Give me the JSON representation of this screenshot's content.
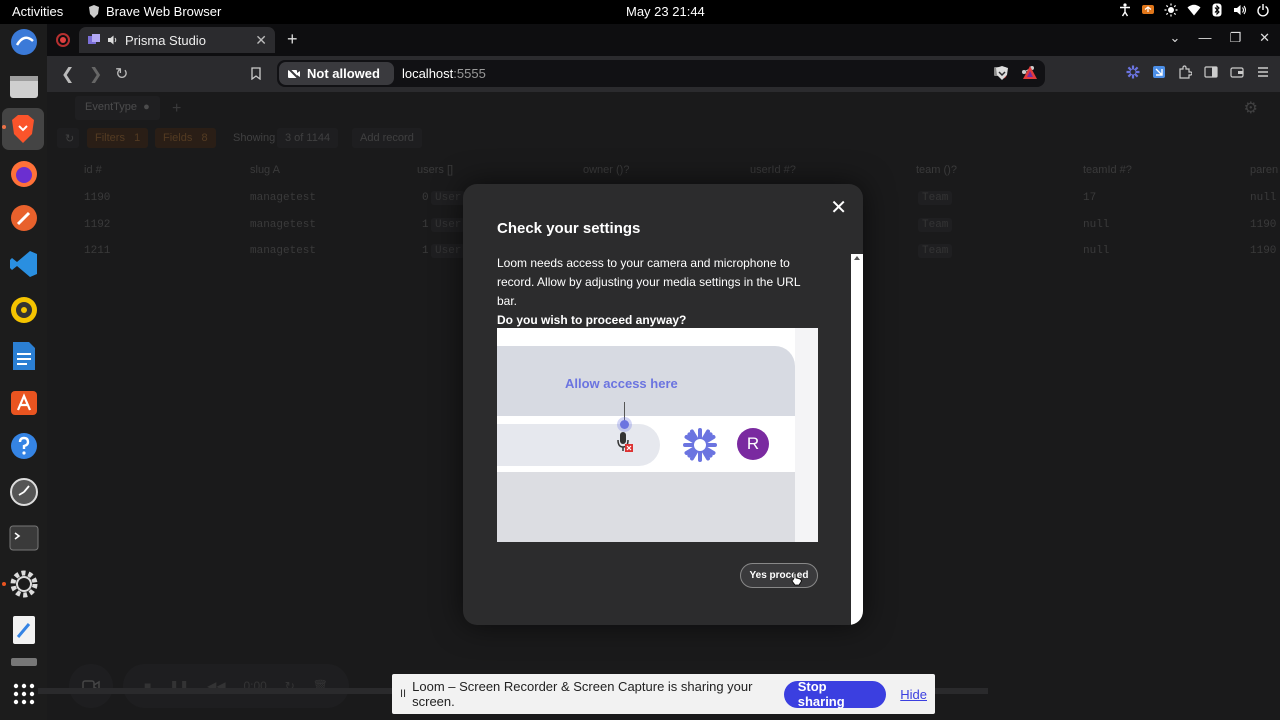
{
  "topbar": {
    "activities": "Activities",
    "app_name": "Brave Web Browser",
    "clock": "May 23  21:44"
  },
  "dock": {
    "items": [
      "browser-globe",
      "files",
      "brave",
      "firefox",
      "pen-app",
      "vscode",
      "rhythmbox",
      "writer",
      "app-center",
      "help",
      "clock",
      "terminal",
      "settings",
      "text-editor",
      "trash",
      "show-apps"
    ]
  },
  "browser": {
    "tab_title": "Prisma Studio",
    "new_tab": "+",
    "permission_label": "Not allowed",
    "url_host": "localhost",
    "url_port": ":5555"
  },
  "app": {
    "model_tab": "EventType",
    "filters": "Filters",
    "filters_count": "1",
    "fields": "Fields",
    "fields_count": "8",
    "showing": "Showing",
    "showing_range": "3 of 1144",
    "add_record": "Add record",
    "columns": [
      "id #",
      "slug A",
      "users []",
      "owner ()?",
      "userId #?",
      "team ()?",
      "teamId #?",
      "paren"
    ],
    "rows": [
      {
        "id": "1190",
        "slug": "managetest",
        "users": "0",
        "users_chip": "User",
        "team_chip": "Team",
        "teamId": "17",
        "parent": "null"
      },
      {
        "id": "1192",
        "slug": "managetest",
        "users": "1",
        "users_chip": "User",
        "team_chip": "Team",
        "teamId": "null",
        "parent": "1190"
      },
      {
        "id": "1211",
        "slug": "managetest",
        "users": "1",
        "users_chip": "User",
        "team_chip": "Team",
        "teamId": "null",
        "parent": "1190"
      }
    ],
    "recorder_time": "0:00"
  },
  "modal": {
    "title": "Check your settings",
    "body": "Loom needs access to your camera and microphone to record. Allow by adjusting your media settings in the URL bar.",
    "question": "Do you wish to proceed anyway?",
    "illustration_label": "Allow access here",
    "avatar_letter": "R",
    "proceed_label": "Yes proceed"
  },
  "sharebar": {
    "pause": "II",
    "message": "Loom – Screen Recorder & Screen Capture is sharing your screen.",
    "stop_label": "Stop sharing",
    "hide_label": "Hide"
  },
  "colors": {
    "accent": "#3b3fe0",
    "loom_purple": "#6b74e0",
    "avatar": "#7a2aa0",
    "ubuntu_orange": "#e95420"
  }
}
